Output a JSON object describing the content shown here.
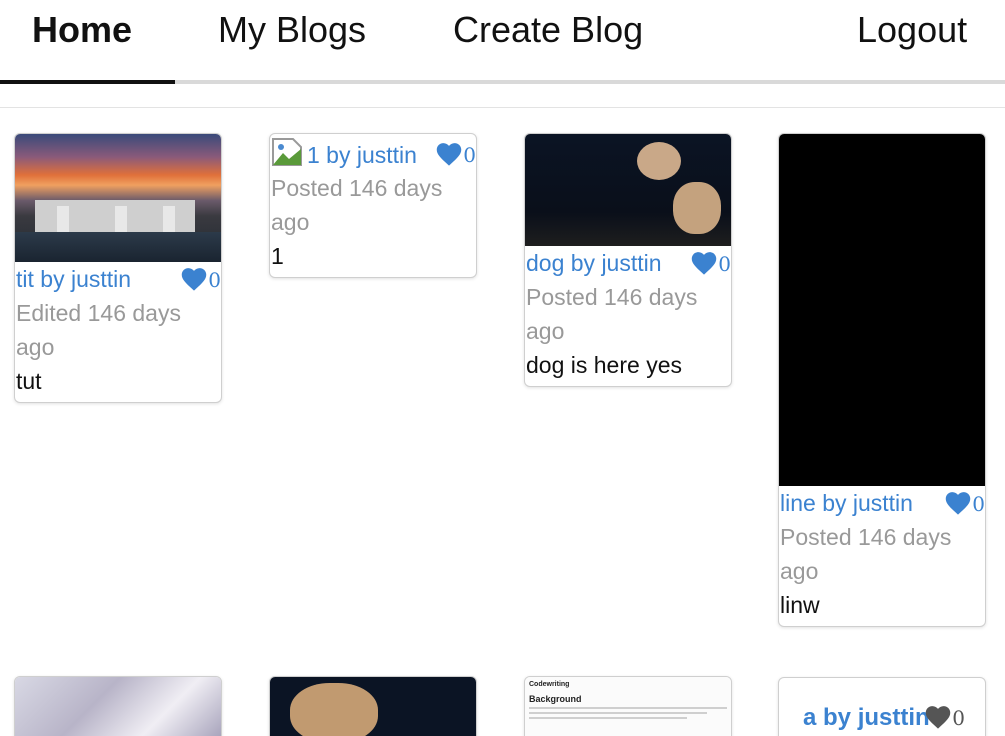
{
  "nav": {
    "home": "Home",
    "my_blogs": "My Blogs",
    "create_blog": "Create Blog",
    "logout": "Logout"
  },
  "colors": {
    "accent": "#3b82d0",
    "muted": "#999999",
    "heart_inactive": "#555555"
  },
  "cards": [
    {
      "title": "tit by justtin",
      "likes": "0",
      "date": "Edited 146 days ago",
      "description": "tut",
      "image": "sunset-dam"
    },
    {
      "title": "1 by justtin",
      "likes": "0",
      "date": "Posted 146 days ago",
      "description": "1",
      "image": "broken-image"
    },
    {
      "title": "dog by justtin",
      "likes": "0",
      "date": "Posted 146 days ago",
      "description": "dog is here yes",
      "image": "two-dogs"
    },
    {
      "title": "line by justtin",
      "likes": "0",
      "date": "Posted 146 days ago",
      "description": "linw",
      "image": "black"
    },
    {
      "image": "anime-character"
    },
    {
      "image": "dog-closeup"
    },
    {
      "image": "document-screenshot",
      "doc_brand": "Codewriting",
      "doc_heading": "Background"
    },
    {
      "title": "a by justtin",
      "likes": "0"
    }
  ]
}
